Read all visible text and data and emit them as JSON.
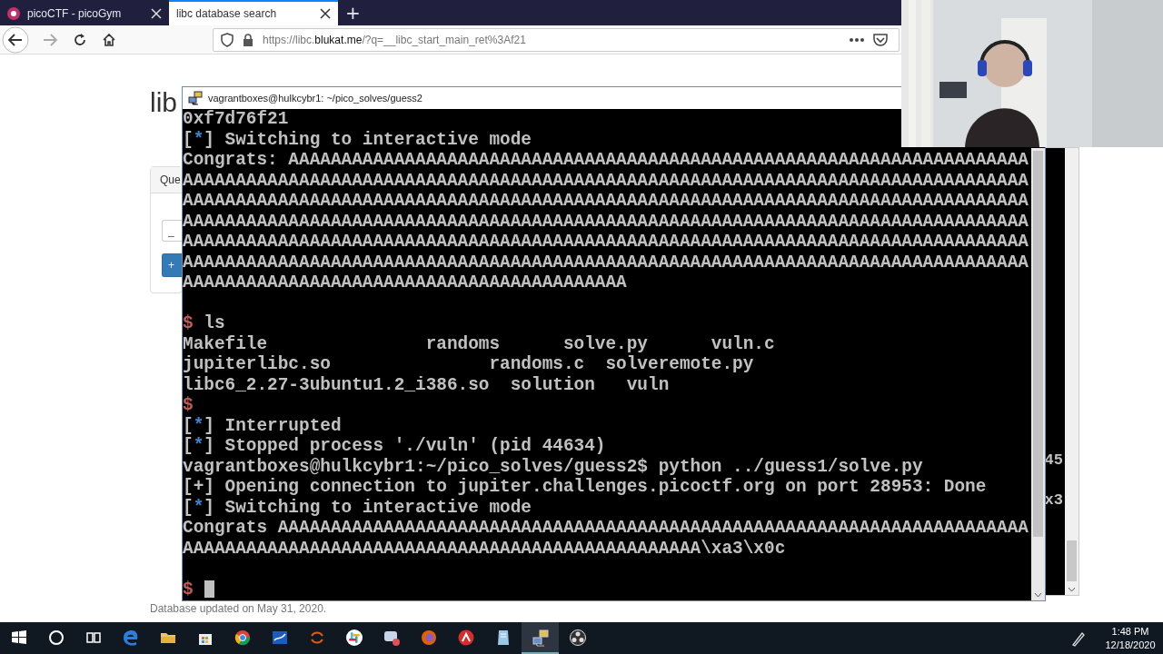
{
  "browser": {
    "tabs": [
      {
        "title": "picoCTF - picoGym",
        "selected": false
      },
      {
        "title": "libc database search",
        "selected": true
      }
    ],
    "new_tab": "+",
    "address": [
      {
        "kind": "dim",
        "text": "https://libc."
      },
      {
        "kind": "strong",
        "text": "blukat.me"
      },
      {
        "kind": "dim",
        "text": "/?q=__libc_start_main_ret%3Af21"
      }
    ],
    "page": {
      "heading": "lib",
      "card_header": "Que",
      "input_value": "_",
      "button_label": "+",
      "footer": "Database updated on May 31, 2020."
    }
  },
  "terminal": {
    "title": "vagrantboxes@hulkcybr1: ~/pico_solves/guess2",
    "lines": [
      {
        "kind": "output",
        "segments": [
          {
            "kind": "text",
            "text": "0xf7d76f21"
          }
        ]
      },
      {
        "kind": "output",
        "segments": [
          {
            "kind": "text",
            "text": "["
          },
          {
            "kind": "marker",
            "text": "*"
          },
          {
            "kind": "text",
            "text": "] Switching to interactive mode"
          }
        ]
      },
      {
        "kind": "output",
        "segments": [
          {
            "kind": "text",
            "text": "Congrats: AAAAAAAAAAAAAAAAAAAAAAAAAAAAAAAAAAAAAAAAAAAAAAAAAAAAAAAAAAAAAAAAAAAAAA"
          }
        ]
      },
      {
        "kind": "output",
        "segments": [
          {
            "kind": "text",
            "text": "AAAAAAAAAAAAAAAAAAAAAAAAAAAAAAAAAAAAAAAAAAAAAAAAAAAAAAAAAAAAAAAAAAAAAAAAAAAAAAAA"
          }
        ]
      },
      {
        "kind": "output",
        "segments": [
          {
            "kind": "text",
            "text": "AAAAAAAAAAAAAAAAAAAAAAAAAAAAAAAAAAAAAAAAAAAAAAAAAAAAAAAAAAAAAAAAAAAAAAAAAAAAAAAA"
          }
        ]
      },
      {
        "kind": "output",
        "segments": [
          {
            "kind": "text",
            "text": "AAAAAAAAAAAAAAAAAAAAAAAAAAAAAAAAAAAAAAAAAAAAAAAAAAAAAAAAAAAAAAAAAAAAAAAAAAAAAAAA"
          }
        ]
      },
      {
        "kind": "output",
        "segments": [
          {
            "kind": "text",
            "text": "AAAAAAAAAAAAAAAAAAAAAAAAAAAAAAAAAAAAAAAAAAAAAAAAAAAAAAAAAAAAAAAAAAAAAAAAAAAAAAAA"
          }
        ]
      },
      {
        "kind": "output",
        "segments": [
          {
            "kind": "text",
            "text": "AAAAAAAAAAAAAAAAAAAAAAAAAAAAAAAAAAAAAAAAAAAAAAAAAAAAAAAAAAAAAAAAAAAAAAAAAAAAAAAA"
          }
        ]
      },
      {
        "kind": "output",
        "segments": [
          {
            "kind": "text",
            "text": "AAAAAAAAAAAAAAAAAAAAAAAAAAAAAAAAAAAAAAAAAA"
          }
        ]
      },
      {
        "kind": "blank"
      },
      {
        "kind": "output",
        "segments": [
          {
            "kind": "prompt",
            "text": "$"
          },
          {
            "kind": "text",
            "text": " ls"
          }
        ]
      },
      {
        "kind": "output",
        "segments": [
          {
            "kind": "text",
            "text": "Makefile               randoms      solve.py      vuln.c"
          }
        ]
      },
      {
        "kind": "output",
        "segments": [
          {
            "kind": "text",
            "text": "jupiterlibc.so               randoms.c  solveremote.py"
          }
        ]
      },
      {
        "kind": "output",
        "segments": [
          {
            "kind": "text",
            "text": "libc6_2.27-3ubuntu1.2_i386.so  solution   vuln"
          }
        ]
      },
      {
        "kind": "output",
        "segments": [
          {
            "kind": "prompt",
            "text": "$"
          }
        ]
      },
      {
        "kind": "output",
        "segments": [
          {
            "kind": "text",
            "text": "["
          },
          {
            "kind": "marker",
            "text": "*"
          },
          {
            "kind": "text",
            "text": "] Interrupted"
          }
        ]
      },
      {
        "kind": "output",
        "segments": [
          {
            "kind": "text",
            "text": "["
          },
          {
            "kind": "marker",
            "text": "*"
          },
          {
            "kind": "text",
            "text": "] Stopped process './vuln' (pid 44634)"
          }
        ]
      },
      {
        "kind": "output",
        "segments": [
          {
            "kind": "text",
            "text": "vagrantboxes@hulkcybr1:~/pico_solves/guess2$ python ../guess1/solve.py"
          }
        ]
      },
      {
        "kind": "output",
        "segments": [
          {
            "kind": "text",
            "text": "[+] Opening connection to jupiter.challenges.picoctf.org on port 28953: Done"
          }
        ]
      },
      {
        "kind": "output",
        "segments": [
          {
            "kind": "text",
            "text": "["
          },
          {
            "kind": "marker",
            "text": "*"
          },
          {
            "kind": "text",
            "text": "] Switching to interactive mode"
          }
        ]
      },
      {
        "kind": "output",
        "segments": [
          {
            "kind": "text",
            "text": "Congrats AAAAAAAAAAAAAAAAAAAAAAAAAAAAAAAAAAAAAAAAAAAAAAAAAAAAAAAAAAAAAAAAAAAAAAA"
          }
        ]
      },
      {
        "kind": "output",
        "segments": [
          {
            "kind": "text",
            "text": "AAAAAAAAAAAAAAAAAAAAAAAAAAAAAAAAAAAAAAAAAAAAAAAAA\\xa3\\x0c"
          }
        ]
      },
      {
        "kind": "blank"
      },
      {
        "kind": "output",
        "segments": [
          {
            "kind": "prompt",
            "text": "$"
          }
        ],
        "cursor": true
      }
    ]
  },
  "back_window": {
    "fragments": [
      "45",
      "x3"
    ]
  },
  "taskbar": {
    "icons": [
      {
        "kind": "start",
        "selected": false
      },
      {
        "kind": "search",
        "selected": false
      },
      {
        "kind": "taskview",
        "selected": false
      },
      {
        "kind": "edge",
        "selected": false
      },
      {
        "kind": "folder",
        "selected": false
      },
      {
        "kind": "store",
        "selected": false
      },
      {
        "kind": "chrome",
        "selected": false
      },
      {
        "kind": "whiteboard",
        "selected": false
      },
      {
        "kind": "ring",
        "selected": false
      },
      {
        "kind": "slack",
        "selected": false
      },
      {
        "kind": "chat",
        "selected": false
      },
      {
        "kind": "firefox",
        "selected": false
      },
      {
        "kind": "redapp",
        "selected": false
      },
      {
        "kind": "notepad",
        "selected": false
      },
      {
        "kind": "putty",
        "selected": true
      },
      {
        "kind": "obs",
        "selected": false
      }
    ],
    "time": "1:48 PM",
    "date": "12/18/2020"
  }
}
